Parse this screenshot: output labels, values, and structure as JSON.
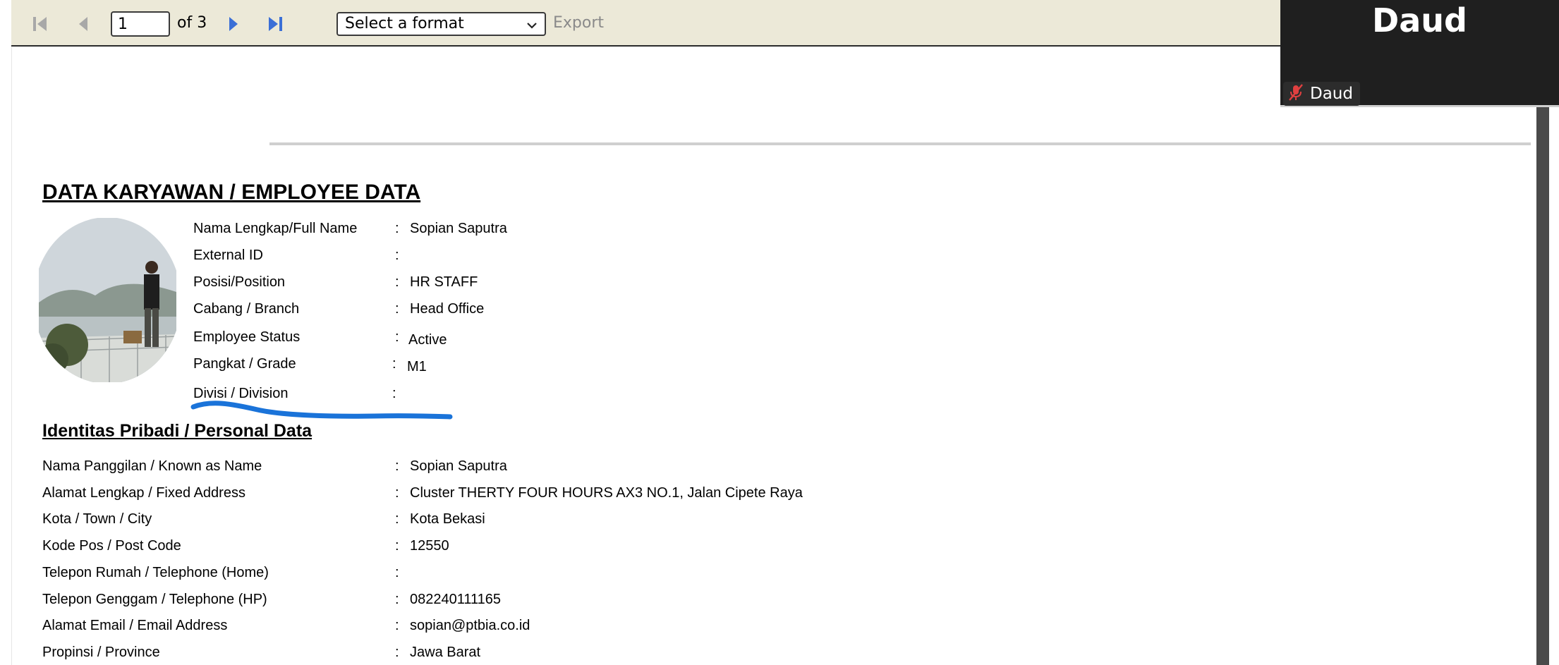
{
  "toolbar": {
    "page_value": "1",
    "of_label": "of 3",
    "format_selected": "Select a format",
    "export_label": "Export"
  },
  "video": {
    "big_name": "Daud",
    "label_name": "Daud",
    "mic_icon": "mic-muted-icon"
  },
  "report": {
    "title": "DATA KARYAWAN / EMPLOYEE DATA",
    "employee_fields": [
      {
        "label": "Nama Lengkap/Full Name",
        "colon": ":",
        "value": "Sopian Saputra"
      },
      {
        "label": "External ID",
        "colon": ":",
        "value": ""
      },
      {
        "label": "Posisi/Position",
        "colon": ":",
        "value": "HR STAFF"
      },
      {
        "label": "Cabang / Branch",
        "colon": ":",
        "value": "Head Office"
      },
      {
        "label": "Employee Status",
        "colon": ":",
        "value": "Active"
      },
      {
        "label": "Pangkat / Grade",
        "colon": ":",
        "value": "M1"
      },
      {
        "label": "Divisi / Division",
        "colon": ":",
        "value": ""
      }
    ],
    "personal_title": "Identitas Pribadi / Personal Data",
    "personal_fields": [
      {
        "label": "Nama Panggilan / Known as Name",
        "colon": ":",
        "value": "Sopian Saputra"
      },
      {
        "label": "Alamat Lengkap / Fixed Address",
        "colon": ":",
        "value": "Cluster THERTY FOUR HOURS AX3 NO.1, Jalan Cipete Raya"
      },
      {
        "label": "Kota / Town / City",
        "colon": ":",
        "value": "Kota Bekasi"
      },
      {
        "label": "Kode Pos / Post Code",
        "colon": ":",
        "value": "12550"
      },
      {
        "label": "Telepon Rumah / Telephone (Home)",
        "colon": ":",
        "value": ""
      },
      {
        "label": "Telepon Genggam / Telephone (HP)",
        "colon": ":",
        "value": "082240111165"
      },
      {
        "label": "Alamat Email / Email Address",
        "colon": ":",
        "value": "sopian@ptbia.co.id"
      },
      {
        "label": "Propinsi / Province",
        "colon": ":",
        "value": "Jawa Barat"
      }
    ]
  },
  "colors": {
    "toolbar_bg": "#ECE9D8",
    "nav_active": "#3b6fd6",
    "annotation": "#1a73d9"
  }
}
